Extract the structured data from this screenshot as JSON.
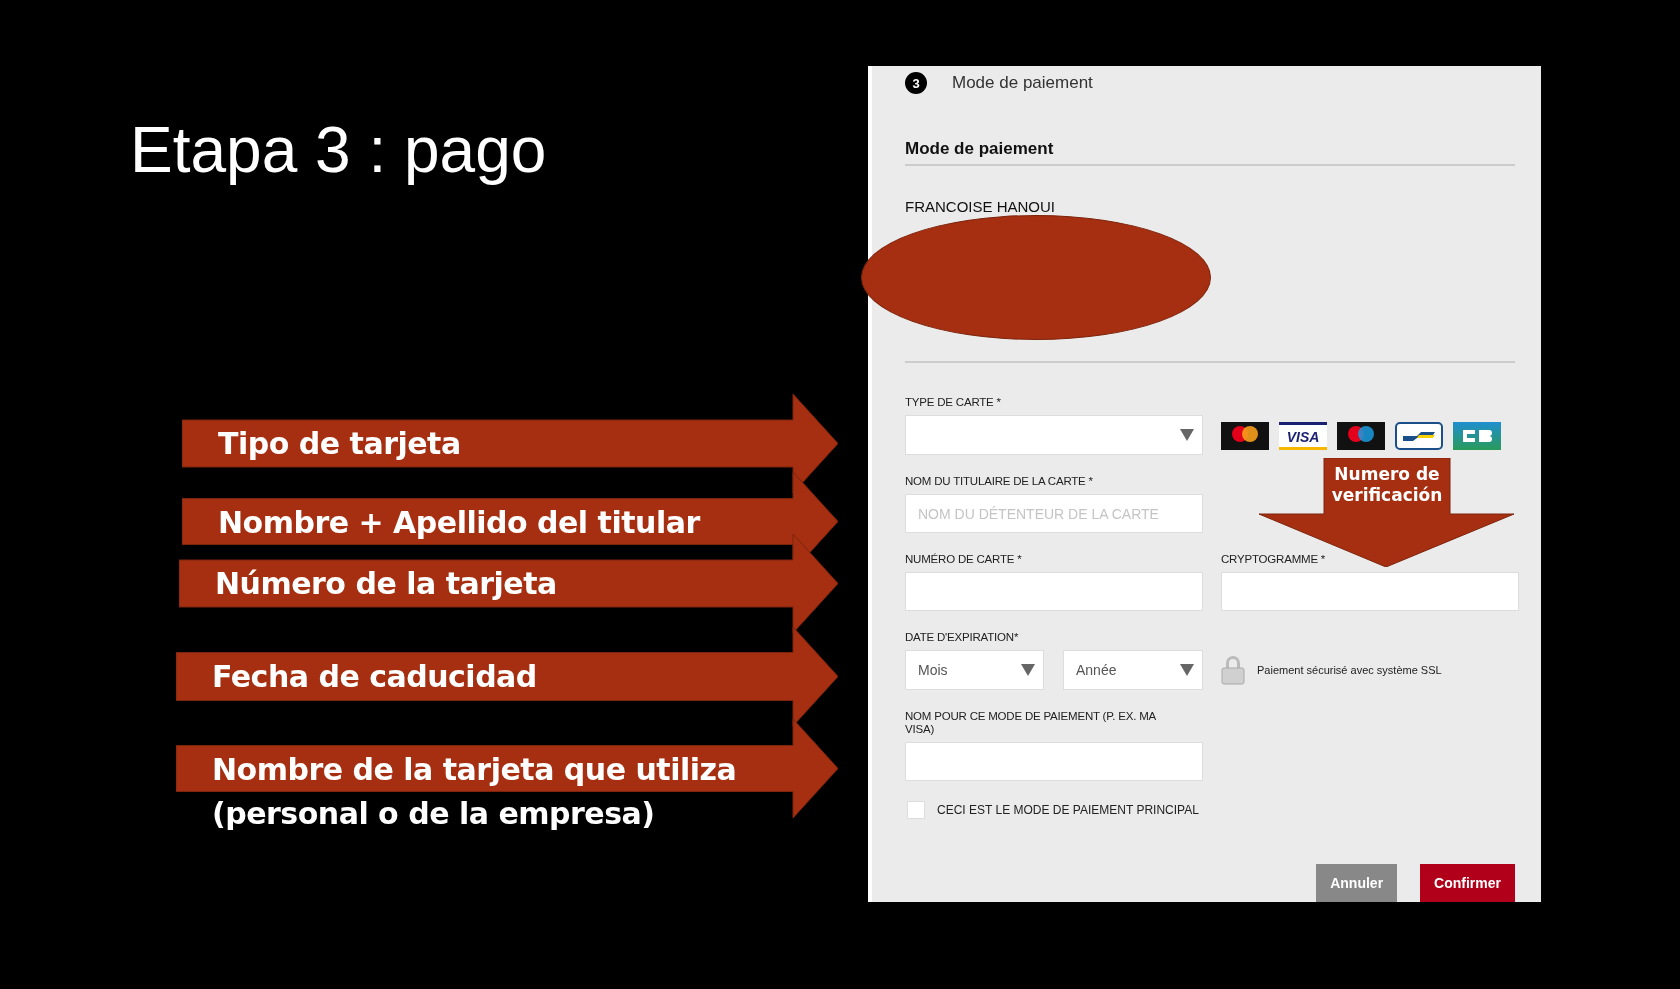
{
  "slide": {
    "title": "Etapa 3 : pago"
  },
  "annotations": [
    {
      "kind": "side-arrow",
      "label": "Tipo de tarjeta"
    },
    {
      "kind": "side-arrow",
      "label": "Nombre + Apellido del titular"
    },
    {
      "kind": "side-arrow",
      "label": "Número de la tarjeta"
    },
    {
      "kind": "side-arrow",
      "label": "Fecha de caducidad"
    },
    {
      "kind": "side-arrow",
      "label": "Nombre de la tarjeta que utiliza",
      "note": "(personal o de la empresa)"
    },
    {
      "kind": "down-arrow",
      "label": "Numero de verificación"
    }
  ],
  "form": {
    "step": "3",
    "step_title": "Mode de paiement",
    "section_title": "Mode de paiement",
    "holder_name": "FRANCOISE HANOUI",
    "card_type": {
      "label": "TYPE DE CARTE *"
    },
    "card_logos": [
      {
        "kind": "mastercard"
      },
      {
        "kind": "visa",
        "text": "VISA"
      },
      {
        "kind": "maestro"
      },
      {
        "kind": "bancontact"
      },
      {
        "kind": "cb"
      }
    ],
    "holder": {
      "label": "NOM DU TITULAIRE DE LA CARTE *",
      "placeholder": "NOM DU DÉTENTEUR DE LA CARTE"
    },
    "card_number": {
      "label": "NUMÉRO DE CARTE *"
    },
    "cvv": {
      "label": "CRYPTOGRAMME *"
    },
    "expiry": {
      "label": "DATE D'EXPIRATION*",
      "month": "Mois",
      "year": "Année"
    },
    "ssl_note": "Paiement sécurisé avec système SSL",
    "nickname": {
      "label": "NOM POUR CE MODE DE PAIEMENT (P. EX. MA VISA)"
    },
    "default_checkbox": {
      "label": "CECI EST LE MODE DE PAIEMENT PRINCIPAL",
      "checked": false
    },
    "buttons": [
      {
        "label": "Annuler",
        "kind": "secondary"
      },
      {
        "label": "Confirmer",
        "kind": "primary"
      }
    ]
  }
}
